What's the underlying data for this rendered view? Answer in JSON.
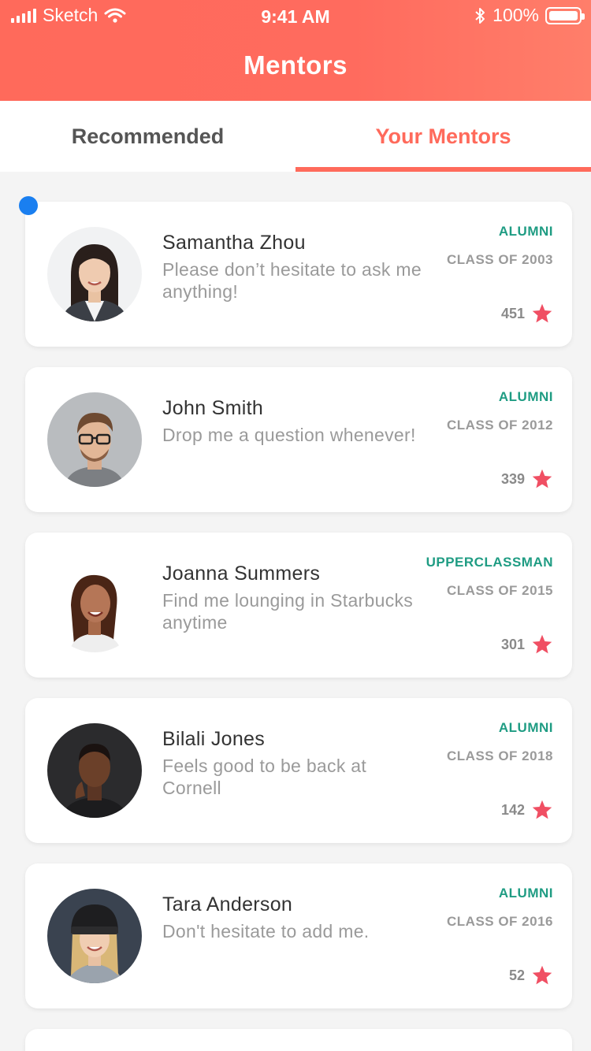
{
  "status_bar": {
    "carrier": "Sketch",
    "time": "9:41 AM",
    "battery": "100%"
  },
  "nav": {
    "title": "Mentors"
  },
  "tabs": [
    {
      "label": "Recommended",
      "active": false
    },
    {
      "label": "Your Mentors",
      "active": true
    }
  ],
  "colors": {
    "accent": "#ff6a5b",
    "role": "#1f9c83",
    "star": "#f04f63",
    "dot": "#1a7ff0"
  },
  "mentors": [
    {
      "name": "Samantha Zhou",
      "bio": "Please don’t hesitate to ask me anything!",
      "role": "ALUMNI",
      "class_year": "CLASS OF 2003",
      "rating": "451",
      "avatar_icon": "portrait-woman-icon"
    },
    {
      "name": "John Smith",
      "bio": "Drop me a question whenever!",
      "role": "ALUMNI",
      "class_year": "CLASS OF 2012",
      "rating": "339",
      "avatar_icon": "portrait-man-glasses-icon"
    },
    {
      "name": "Joanna Summers",
      "bio": "Find me lounging in Starbucks anytime",
      "role": "UPPERCLASSMAN",
      "class_year": "CLASS OF 2015",
      "rating": "301",
      "avatar_icon": "portrait-woman-icon"
    },
    {
      "name": "Bilali Jones",
      "bio": "Feels good to be back at Cornell",
      "role": "ALUMNI",
      "class_year": "CLASS OF 2018",
      "rating": "142",
      "avatar_icon": "portrait-man-icon"
    },
    {
      "name": "Tara Anderson",
      "bio": "Don't hesitate to add me.",
      "role": "ALUMNI",
      "class_year": "CLASS OF 2016",
      "rating": "52",
      "avatar_icon": "portrait-woman-beanie-icon"
    }
  ]
}
